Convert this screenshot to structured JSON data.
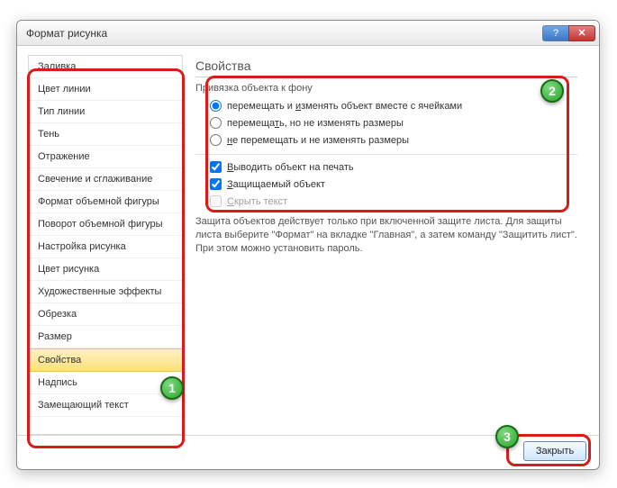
{
  "title": "Формат рисунка",
  "titlebar": {
    "help": "?",
    "close": "✕"
  },
  "sidebar": {
    "items": [
      {
        "label": "Заливка"
      },
      {
        "label": "Цвет линии"
      },
      {
        "label": "Тип линии"
      },
      {
        "label": "Тень"
      },
      {
        "label": "Отражение"
      },
      {
        "label": "Свечение и сглаживание"
      },
      {
        "label": "Формат объемной фигуры"
      },
      {
        "label": "Поворот объемной фигуры"
      },
      {
        "label": "Настройка рисунка"
      },
      {
        "label": "Цвет рисунка"
      },
      {
        "label": "Художественные эффекты"
      },
      {
        "label": "Обрезка"
      },
      {
        "label": "Размер"
      },
      {
        "label": "Свойства",
        "selected": true
      },
      {
        "label": "Надпись"
      },
      {
        "label": "Замещающий текст"
      }
    ]
  },
  "panel": {
    "heading": "Свойства",
    "group_label": "Привязка объекта к фону",
    "radios": [
      {
        "pre": "перемещать и ",
        "ul": "и",
        "post": "зменять объект вместе с ячейками",
        "checked": true
      },
      {
        "pre": "перемеща",
        "ul": "т",
        "post": "ь, но не изменять размеры",
        "checked": false
      },
      {
        "pre": "",
        "ul": "н",
        "post": "е перемещать и не изменять размеры",
        "checked": false
      }
    ],
    "checks": [
      {
        "pre": "",
        "ul": "В",
        "post": "ыводить объект на печать",
        "checked": true
      },
      {
        "pre": "",
        "ul": "З",
        "post": "ащищаемый объект",
        "checked": true
      },
      {
        "pre": "",
        "ul": "С",
        "post": "крыть текст",
        "checked": false,
        "disabled": true
      }
    ],
    "info": "Защита объектов действует только при включенной защите листа. Для защиты листа выберите \"Формат\" на вкладке \"Главная\", а затем команду \"Защитить лист\". При этом можно установить пароль."
  },
  "footer": {
    "close_label": "Закрыть"
  },
  "badges": {
    "b1": "1",
    "b2": "2",
    "b3": "3"
  }
}
